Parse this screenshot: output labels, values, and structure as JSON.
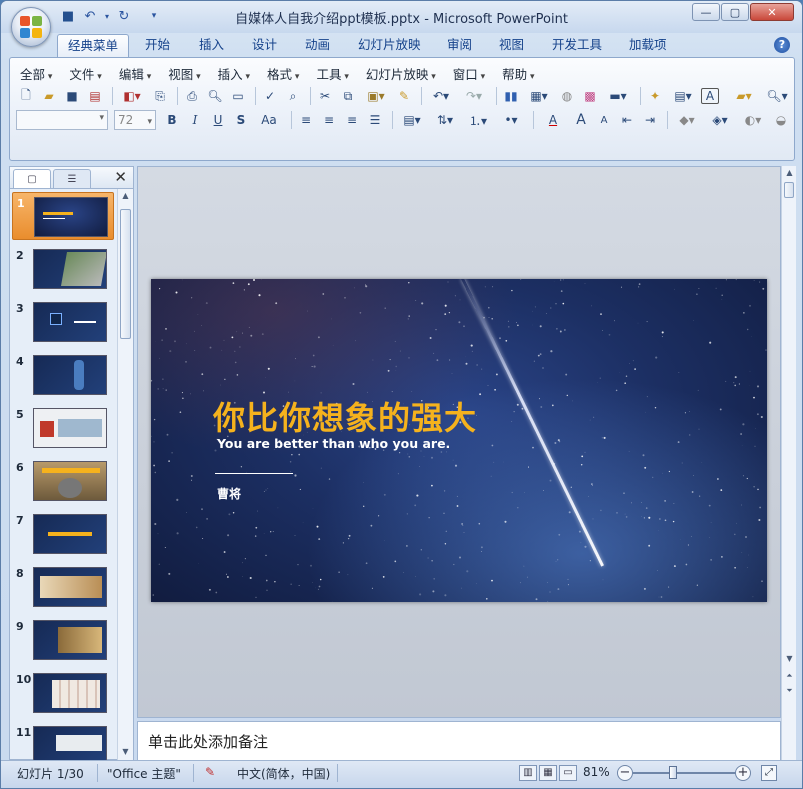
{
  "window": {
    "title": "自媒体人自我介绍ppt模板.pptx - Microsoft PowerPoint",
    "controls": {
      "minimize": "—",
      "maximize": "▢",
      "close": "✕"
    }
  },
  "quick_access": [
    {
      "name": "save-icon",
      "glyph": "💾"
    },
    {
      "name": "undo-icon",
      "glyph": "↶"
    },
    {
      "name": "redo-icon",
      "glyph": "↷"
    },
    {
      "name": "customize-icon",
      "glyph": "▾"
    }
  ],
  "ribbon_tabs": [
    "经典菜单",
    "开始",
    "插入",
    "设计",
    "动画",
    "幻灯片放映",
    "审阅",
    "视图",
    "开发工具",
    "加载项"
  ],
  "active_tab": "经典菜单",
  "menu_items": [
    "全部",
    "文件",
    "编辑",
    "视图",
    "插入",
    "格式",
    "工具",
    "幻灯片放映",
    "窗口",
    "帮助"
  ],
  "font_box": {
    "name": "",
    "size": "72"
  },
  "format_buttons": {
    "bold": "B",
    "italic": "I",
    "underline": "U",
    "shadow": "S",
    "case": "Aa",
    "font_color": "A",
    "grow": "A",
    "shrink": "A"
  },
  "left_panel": {
    "tab_slides_icon": "▢",
    "tab_outline_icon": "☰",
    "close": "✕",
    "slides": [
      {
        "number": "1",
        "selected": true
      },
      {
        "number": "2"
      },
      {
        "number": "3"
      },
      {
        "number": "4"
      },
      {
        "number": "5"
      },
      {
        "number": "6"
      },
      {
        "number": "7"
      },
      {
        "number": "8"
      },
      {
        "number": "9"
      },
      {
        "number": "10"
      },
      {
        "number": "11"
      }
    ]
  },
  "slide": {
    "title": "你比你想象的强大",
    "subtitle": "You are better than who you are.",
    "author": "曹将"
  },
  "notes": {
    "placeholder": "单击此处添加备注"
  },
  "status_bar": {
    "slide_info": "幻灯片 1/30",
    "theme": "\"Office 主题\"",
    "language": "中文(简体，中国)",
    "zoom": "81%",
    "zoom_minus": "−",
    "zoom_plus": "+"
  },
  "colors": {
    "title_accent": "#f5b21d",
    "selected_thumb": "#e98d2d",
    "ribbon_text": "#15428b"
  }
}
